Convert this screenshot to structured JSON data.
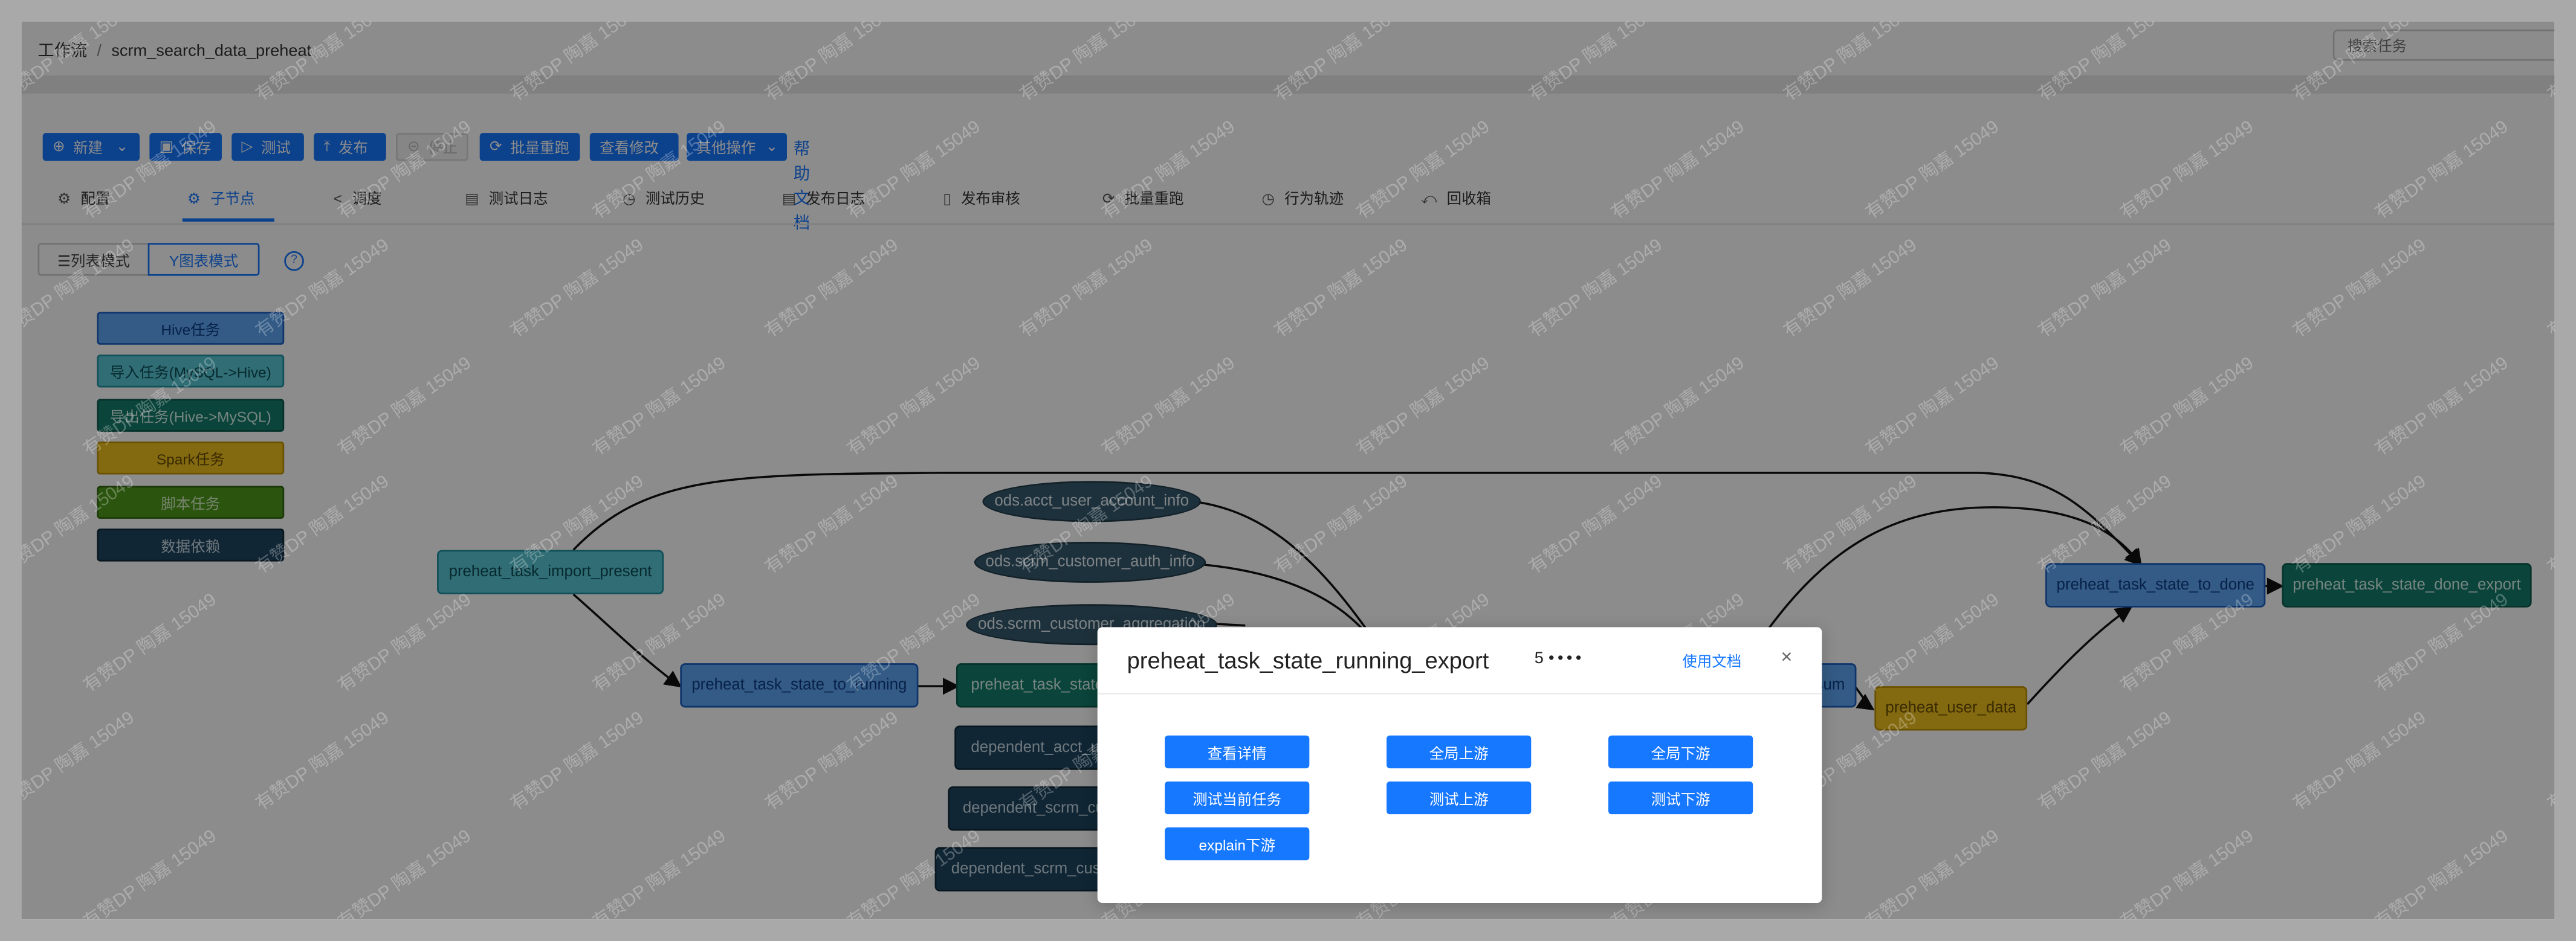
{
  "breadcrumb": {
    "root": "工作流",
    "separator": "/",
    "current": "scrm_search_data_preheat"
  },
  "search": {
    "placeholder": "搜索任务"
  },
  "toolbar": {
    "new": "新建",
    "save": "保存",
    "test": "测试",
    "publish": "发布",
    "stop": "停止",
    "batch_rerun": "批量重跑",
    "view_changes": "查看修改",
    "other_ops": "其他操作",
    "help_doc": "帮助文档"
  },
  "tabs": [
    {
      "label": "配置",
      "icon": "gear-icon"
    },
    {
      "label": "子节点",
      "icon": "gear-icon",
      "active": true
    },
    {
      "label": "调度",
      "icon": "share-icon"
    },
    {
      "label": "测试日志",
      "icon": "log-icon"
    },
    {
      "label": "测试历史",
      "icon": "clock-icon"
    },
    {
      "label": "发布日志",
      "icon": "log-icon"
    },
    {
      "label": "发布审核",
      "icon": "audit-icon"
    },
    {
      "label": "批量重跑",
      "icon": "rerun-icon"
    },
    {
      "label": "行为轨迹",
      "icon": "clock-icon"
    },
    {
      "label": "回收箱",
      "icon": "recycle-icon"
    }
  ],
  "view_mode": {
    "list": "☰列表模式",
    "chart": "Y图表模式",
    "help": "?"
  },
  "legend": [
    {
      "label": "Hive任务"
    },
    {
      "label": "导入任务(MySQL->Hive)"
    },
    {
      "label": "导出任务(Hive->MySQL)"
    },
    {
      "label": "Spark任务"
    },
    {
      "label": "脚本任务"
    },
    {
      "label": "数据依赖"
    }
  ],
  "graph": {
    "nodes": {
      "import_present": "preheat_task_import_present",
      "state_to_running": "preheat_task_state_to_running",
      "state_running_export": "preheat_task_state_running_export",
      "dep1": "dependent_acct_user_account_info",
      "dep2": "dependent_scrm_customer_auth_info",
      "dep3": "dependent_scrm_customer_aggregation",
      "mid_hive": "preheat_user_data_sum",
      "user_data": "preheat_user_data",
      "state_to_done": "preheat_task_state_to_done",
      "state_done_export": "preheat_task_state_done_export"
    },
    "sources": {
      "s1": "ods.acct_user_account_info",
      "s2": "ods.scrm_customer_auth_info",
      "s3": "ods.scrm_customer_aggregation"
    }
  },
  "watermark": "有赞DP 陶嘉 15049",
  "modal": {
    "title": "preheat_task_state_running_export",
    "rating_num": "5",
    "rating_dots": "••••",
    "doc_link": "使用文档",
    "close": "×",
    "actions": {
      "detail": "查看详情",
      "global_upstream": "全局上游",
      "global_downstream": "全局下游",
      "test_current": "测试当前任务",
      "test_upstream": "测试上游",
      "test_downstream": "测试下游",
      "explain_downstream": "explain下游"
    }
  }
}
